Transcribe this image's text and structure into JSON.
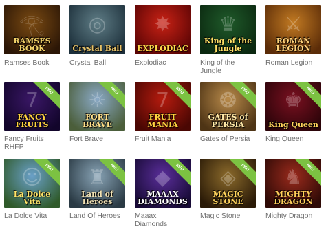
{
  "games": [
    {
      "title": "Ramses Book",
      "logo": "RAMSES BOOK",
      "glyph": "𓂀",
      "bg": [
        "#7a4a12",
        "#2b1606"
      ],
      "logo_color": "#f3d36a",
      "is_new": false
    },
    {
      "title": "Crystal Ball",
      "logo": "Crystal Ball",
      "glyph": "◎",
      "bg": [
        "#5f7d86",
        "#1c2f3a"
      ],
      "logo_color": "#e9c46a",
      "is_new": false
    },
    {
      "title": "Explodiac",
      "logo": "EXPLODIAC",
      "glyph": "✸",
      "bg": [
        "#c92215",
        "#5a0404"
      ],
      "logo_color": "#ffd84a",
      "is_new": false
    },
    {
      "title": "King of the Jungle",
      "logo": "King of the Jungle",
      "glyph": "♛",
      "bg": [
        "#1f5a2a",
        "#0b2810"
      ],
      "logo_color": "#ffe066",
      "is_new": false
    },
    {
      "title": "Roman Legion",
      "logo": "ROMAN LEGION",
      "glyph": "⚔",
      "bg": [
        "#c27a22",
        "#5b2c08"
      ],
      "logo_color": "#ffd27a",
      "is_new": false
    },
    {
      "title": "Fancy Fruits RHFP",
      "logo": "FANCY FRUITS",
      "glyph": "7",
      "bg": [
        "#3a1766",
        "#12052b"
      ],
      "logo_color": "#ffd23f",
      "is_new": true
    },
    {
      "title": "Fort Brave",
      "logo": "FORT BRAVE",
      "glyph": "☼",
      "bg": [
        "#8aa9c6",
        "#4b5e3a"
      ],
      "logo_color": "#ffe08a",
      "is_new": true
    },
    {
      "title": "Fruit Mania",
      "logo": "FRUIT MANIA",
      "glyph": "7",
      "bg": [
        "#b51b0e",
        "#4a0703"
      ],
      "logo_color": "#ffd23f",
      "is_new": true
    },
    {
      "title": "Gates of Persia",
      "logo": "GATES of PERSIA",
      "glyph": "❂",
      "bg": [
        "#b88a4a",
        "#4e3415"
      ],
      "logo_color": "#ffe9a8",
      "is_new": true
    },
    {
      "title": "King Queen",
      "logo": "King Queen",
      "glyph": "♚",
      "bg": [
        "#7a1020",
        "#2b0409"
      ],
      "logo_color": "#ffd45c",
      "is_new": true
    },
    {
      "title": "La Dolce Vita",
      "logo": "La Dolce Vita",
      "glyph": "☺",
      "bg": [
        "#6aa0c8",
        "#2f5a2a"
      ],
      "logo_color": "#ffe66a",
      "is_new": true
    },
    {
      "title": "Land Of Heroes",
      "logo": "Land of Heroes",
      "glyph": "♜",
      "bg": [
        "#88a3b5",
        "#2a3a44"
      ],
      "logo_color": "#f1e2b5",
      "is_new": true
    },
    {
      "title": "Maaax Diamonds",
      "logo": "MAAAX DIAMONDS",
      "glyph": "◆",
      "bg": [
        "#5a2e9a",
        "#170a35"
      ],
      "logo_color": "#ffffff",
      "is_new": true
    },
    {
      "title": "Magic Stone",
      "logo": "MAGIC STONE",
      "glyph": "◈",
      "bg": [
        "#8b6a2b",
        "#2a1a07"
      ],
      "logo_color": "#ffd45c",
      "is_new": true
    },
    {
      "title": "Mighty Dragon",
      "logo": "MIGHTY DRAGON",
      "glyph": "♞",
      "bg": [
        "#9a2a1c",
        "#2e0a06"
      ],
      "logo_color": "#ffcf5a",
      "is_new": true
    }
  ],
  "new_badge_text": "NEU"
}
